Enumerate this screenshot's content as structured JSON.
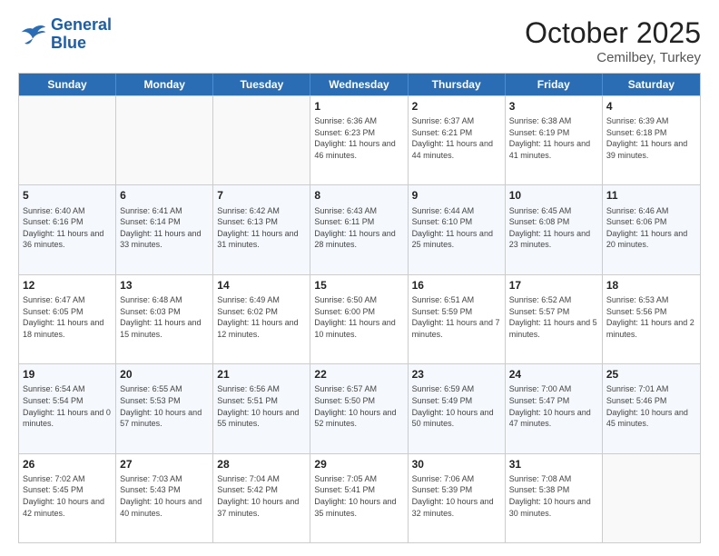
{
  "logo": {
    "line1": "General",
    "line2": "Blue"
  },
  "title": "October 2025",
  "location": "Cemilbey, Turkey",
  "days_of_week": [
    "Sunday",
    "Monday",
    "Tuesday",
    "Wednesday",
    "Thursday",
    "Friday",
    "Saturday"
  ],
  "weeks": [
    [
      {
        "day": "",
        "info": ""
      },
      {
        "day": "",
        "info": ""
      },
      {
        "day": "",
        "info": ""
      },
      {
        "day": "1",
        "info": "Sunrise: 6:36 AM\nSunset: 6:23 PM\nDaylight: 11 hours and 46 minutes."
      },
      {
        "day": "2",
        "info": "Sunrise: 6:37 AM\nSunset: 6:21 PM\nDaylight: 11 hours and 44 minutes."
      },
      {
        "day": "3",
        "info": "Sunrise: 6:38 AM\nSunset: 6:19 PM\nDaylight: 11 hours and 41 minutes."
      },
      {
        "day": "4",
        "info": "Sunrise: 6:39 AM\nSunset: 6:18 PM\nDaylight: 11 hours and 39 minutes."
      }
    ],
    [
      {
        "day": "5",
        "info": "Sunrise: 6:40 AM\nSunset: 6:16 PM\nDaylight: 11 hours and 36 minutes."
      },
      {
        "day": "6",
        "info": "Sunrise: 6:41 AM\nSunset: 6:14 PM\nDaylight: 11 hours and 33 minutes."
      },
      {
        "day": "7",
        "info": "Sunrise: 6:42 AM\nSunset: 6:13 PM\nDaylight: 11 hours and 31 minutes."
      },
      {
        "day": "8",
        "info": "Sunrise: 6:43 AM\nSunset: 6:11 PM\nDaylight: 11 hours and 28 minutes."
      },
      {
        "day": "9",
        "info": "Sunrise: 6:44 AM\nSunset: 6:10 PM\nDaylight: 11 hours and 25 minutes."
      },
      {
        "day": "10",
        "info": "Sunrise: 6:45 AM\nSunset: 6:08 PM\nDaylight: 11 hours and 23 minutes."
      },
      {
        "day": "11",
        "info": "Sunrise: 6:46 AM\nSunset: 6:06 PM\nDaylight: 11 hours and 20 minutes."
      }
    ],
    [
      {
        "day": "12",
        "info": "Sunrise: 6:47 AM\nSunset: 6:05 PM\nDaylight: 11 hours and 18 minutes."
      },
      {
        "day": "13",
        "info": "Sunrise: 6:48 AM\nSunset: 6:03 PM\nDaylight: 11 hours and 15 minutes."
      },
      {
        "day": "14",
        "info": "Sunrise: 6:49 AM\nSunset: 6:02 PM\nDaylight: 11 hours and 12 minutes."
      },
      {
        "day": "15",
        "info": "Sunrise: 6:50 AM\nSunset: 6:00 PM\nDaylight: 11 hours and 10 minutes."
      },
      {
        "day": "16",
        "info": "Sunrise: 6:51 AM\nSunset: 5:59 PM\nDaylight: 11 hours and 7 minutes."
      },
      {
        "day": "17",
        "info": "Sunrise: 6:52 AM\nSunset: 5:57 PM\nDaylight: 11 hours and 5 minutes."
      },
      {
        "day": "18",
        "info": "Sunrise: 6:53 AM\nSunset: 5:56 PM\nDaylight: 11 hours and 2 minutes."
      }
    ],
    [
      {
        "day": "19",
        "info": "Sunrise: 6:54 AM\nSunset: 5:54 PM\nDaylight: 11 hours and 0 minutes."
      },
      {
        "day": "20",
        "info": "Sunrise: 6:55 AM\nSunset: 5:53 PM\nDaylight: 10 hours and 57 minutes."
      },
      {
        "day": "21",
        "info": "Sunrise: 6:56 AM\nSunset: 5:51 PM\nDaylight: 10 hours and 55 minutes."
      },
      {
        "day": "22",
        "info": "Sunrise: 6:57 AM\nSunset: 5:50 PM\nDaylight: 10 hours and 52 minutes."
      },
      {
        "day": "23",
        "info": "Sunrise: 6:59 AM\nSunset: 5:49 PM\nDaylight: 10 hours and 50 minutes."
      },
      {
        "day": "24",
        "info": "Sunrise: 7:00 AM\nSunset: 5:47 PM\nDaylight: 10 hours and 47 minutes."
      },
      {
        "day": "25",
        "info": "Sunrise: 7:01 AM\nSunset: 5:46 PM\nDaylight: 10 hours and 45 minutes."
      }
    ],
    [
      {
        "day": "26",
        "info": "Sunrise: 7:02 AM\nSunset: 5:45 PM\nDaylight: 10 hours and 42 minutes."
      },
      {
        "day": "27",
        "info": "Sunrise: 7:03 AM\nSunset: 5:43 PM\nDaylight: 10 hours and 40 minutes."
      },
      {
        "day": "28",
        "info": "Sunrise: 7:04 AM\nSunset: 5:42 PM\nDaylight: 10 hours and 37 minutes."
      },
      {
        "day": "29",
        "info": "Sunrise: 7:05 AM\nSunset: 5:41 PM\nDaylight: 10 hours and 35 minutes."
      },
      {
        "day": "30",
        "info": "Sunrise: 7:06 AM\nSunset: 5:39 PM\nDaylight: 10 hours and 32 minutes."
      },
      {
        "day": "31",
        "info": "Sunrise: 7:08 AM\nSunset: 5:38 PM\nDaylight: 10 hours and 30 minutes."
      },
      {
        "day": "",
        "info": ""
      }
    ]
  ]
}
